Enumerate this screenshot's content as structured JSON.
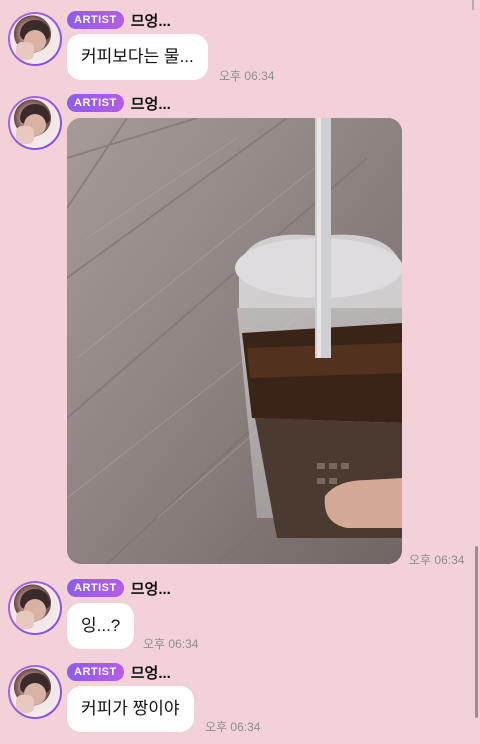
{
  "messages": [
    {
      "badge": "ARTIST",
      "sender": "므엉...",
      "type": "text",
      "text": "커피보다는 물...",
      "time": "오후 06:34"
    },
    {
      "badge": "ARTIST",
      "sender": "므엉...",
      "type": "image",
      "image_description_icon": "photo-iced-coffee",
      "time": "오후 06:34"
    },
    {
      "badge": "ARTIST",
      "sender": "므엉...",
      "type": "text",
      "text": "잉...?",
      "time": "오후 06:34"
    },
    {
      "badge": "ARTIST",
      "sender": "므엉...",
      "type": "text",
      "text": "커피가 짱이야",
      "time": "오후 06:34"
    }
  ],
  "colors": {
    "background": "#f2d2d8",
    "bubble": "#ffffff",
    "badge_start": "#8d5cf0",
    "badge_end": "#b55de3",
    "timestamp": "#8e8e8e"
  }
}
